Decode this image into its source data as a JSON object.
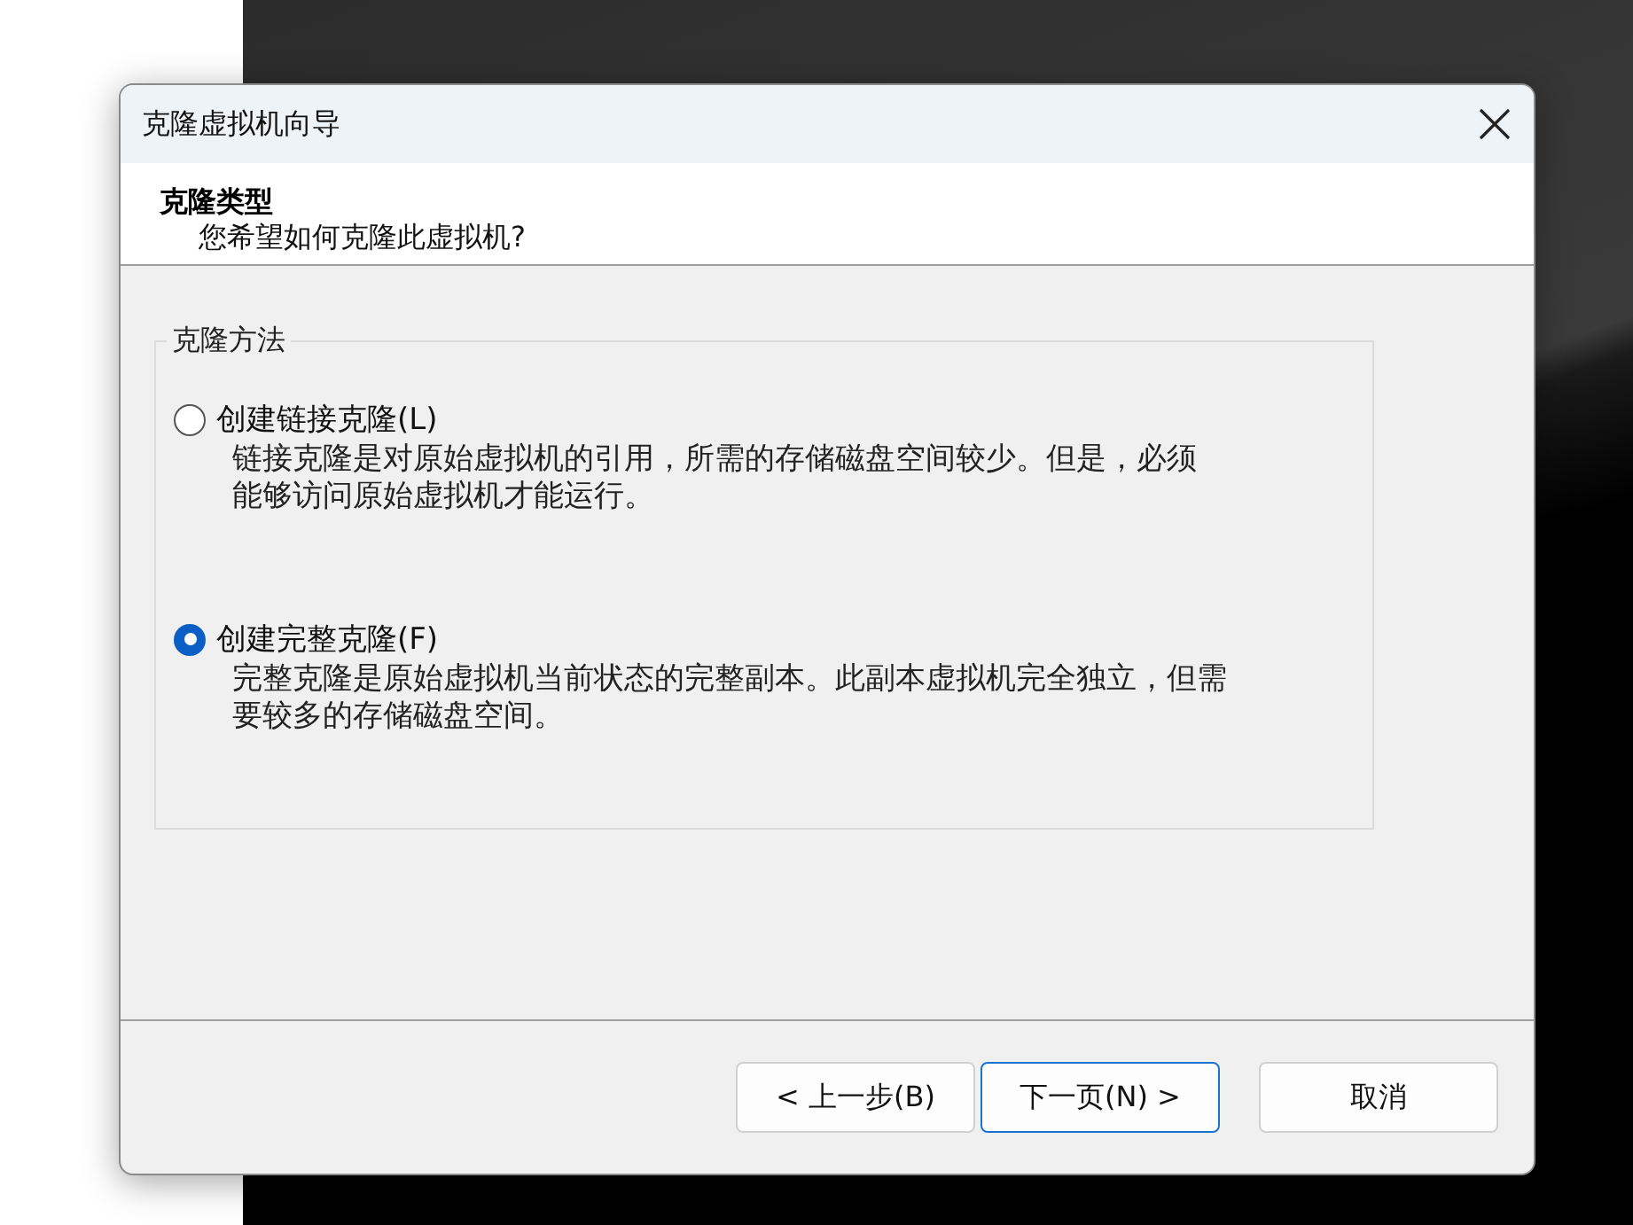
{
  "window": {
    "title": "克隆虚拟机向导"
  },
  "header": {
    "title": "克隆类型",
    "subtitle": "您希望如何克隆此虚拟机?"
  },
  "group": {
    "legend": "克隆方法"
  },
  "options": [
    {
      "label": "创建链接克隆(L)",
      "description_lines": [
        "链接克隆是对原始虚拟机的引用，所需的存储磁盘空间较少。但是，必须",
        "能够访问原始虚拟机才能运行。"
      ],
      "selected": false
    },
    {
      "label": "创建完整克隆(F)",
      "description_lines": [
        "完整克隆是原始虚拟机当前状态的完整副本。此副本虚拟机完全独立，但需",
        "要较多的存储磁盘空间。"
      ],
      "selected": true
    }
  ],
  "buttons": [
    {
      "label": "< 上一步(B)",
      "default": false
    },
    {
      "label": "下一页(N) >",
      "default": true
    },
    {
      "label": "取消",
      "default": false
    }
  ]
}
